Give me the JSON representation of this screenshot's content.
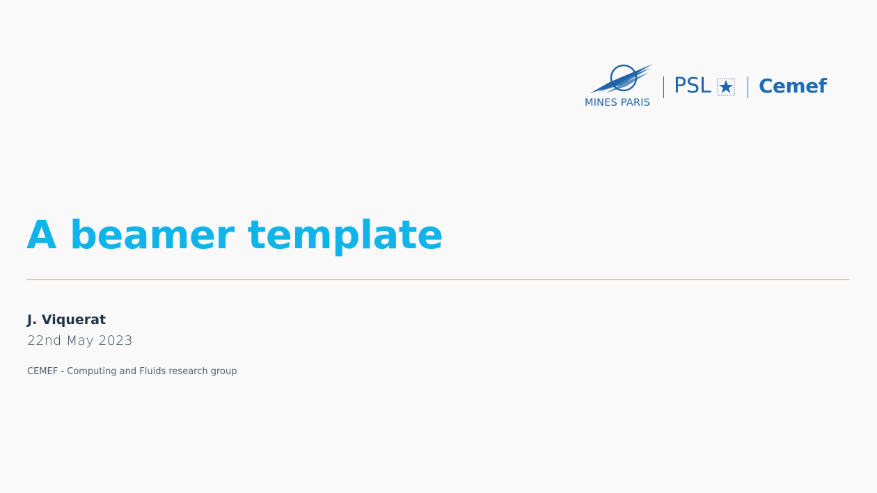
{
  "slide": {
    "title": "A beamer template",
    "author": "J. Viquerat",
    "date": "22nd May 2023",
    "affiliation": "CEMEF - Computing and Fluids research group"
  },
  "logos": {
    "mines": {
      "label": "MINES PARIS",
      "icon": "mines-emblem-icon"
    },
    "psl": {
      "label": "PSL",
      "icon": "star-icon"
    },
    "cemef": {
      "label": "Cemef"
    }
  },
  "colors": {
    "title": "#10b4e9",
    "rule": "#f1c58f",
    "logo_blue": "#1f63a8",
    "text_dark": "#243443",
    "background": "#f9f9f9"
  }
}
